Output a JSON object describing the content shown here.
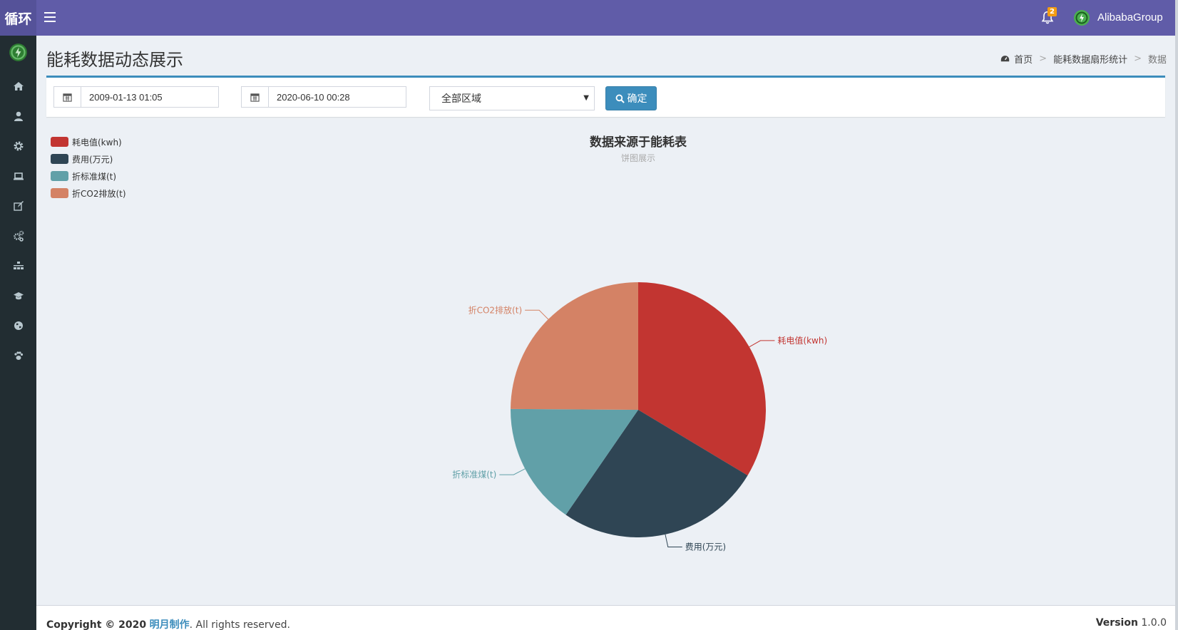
{
  "header": {
    "brand": "循环",
    "notification_count": "2",
    "user_name": "AlibabaGroup"
  },
  "sidebar": {
    "items": [
      {
        "icon": "home-icon"
      },
      {
        "icon": "user-icon"
      },
      {
        "icon": "gear-icon"
      },
      {
        "icon": "laptop-icon"
      },
      {
        "icon": "edit-icon"
      },
      {
        "icon": "cogs-icon"
      },
      {
        "icon": "sitemap-icon"
      },
      {
        "icon": "graduation-cap-icon"
      },
      {
        "icon": "globe-icon"
      },
      {
        "icon": "paw-icon"
      }
    ]
  },
  "page": {
    "title": "能耗数据动态展示",
    "breadcrumb": [
      "首页",
      "能耗数据扇形统计",
      "数据"
    ]
  },
  "filters": {
    "start_date": "2009-01-13 01:05",
    "end_date": "2020-06-10 00:28",
    "area": "全部区域",
    "confirm_label": "确定"
  },
  "chart_data": {
    "type": "pie",
    "title": "数据来源于能耗表",
    "subtitle": "饼图展示",
    "legend_position": "top-left",
    "categories": [
      "耗电值(kwh)",
      "费用(万元)",
      "折标准煤(t)",
      "折CO2排放(t)"
    ],
    "values": [
      33.6,
      26.0,
      15.5,
      24.9
    ],
    "colors": [
      "#c23531",
      "#2f4554",
      "#61a0a8",
      "#d48265"
    ]
  },
  "footer": {
    "copyright_prefix": "Copyright © 2020",
    "author": "明月制作",
    "rights": ". All rights reserved.",
    "version_label": "Version",
    "version": "1.0.0"
  }
}
